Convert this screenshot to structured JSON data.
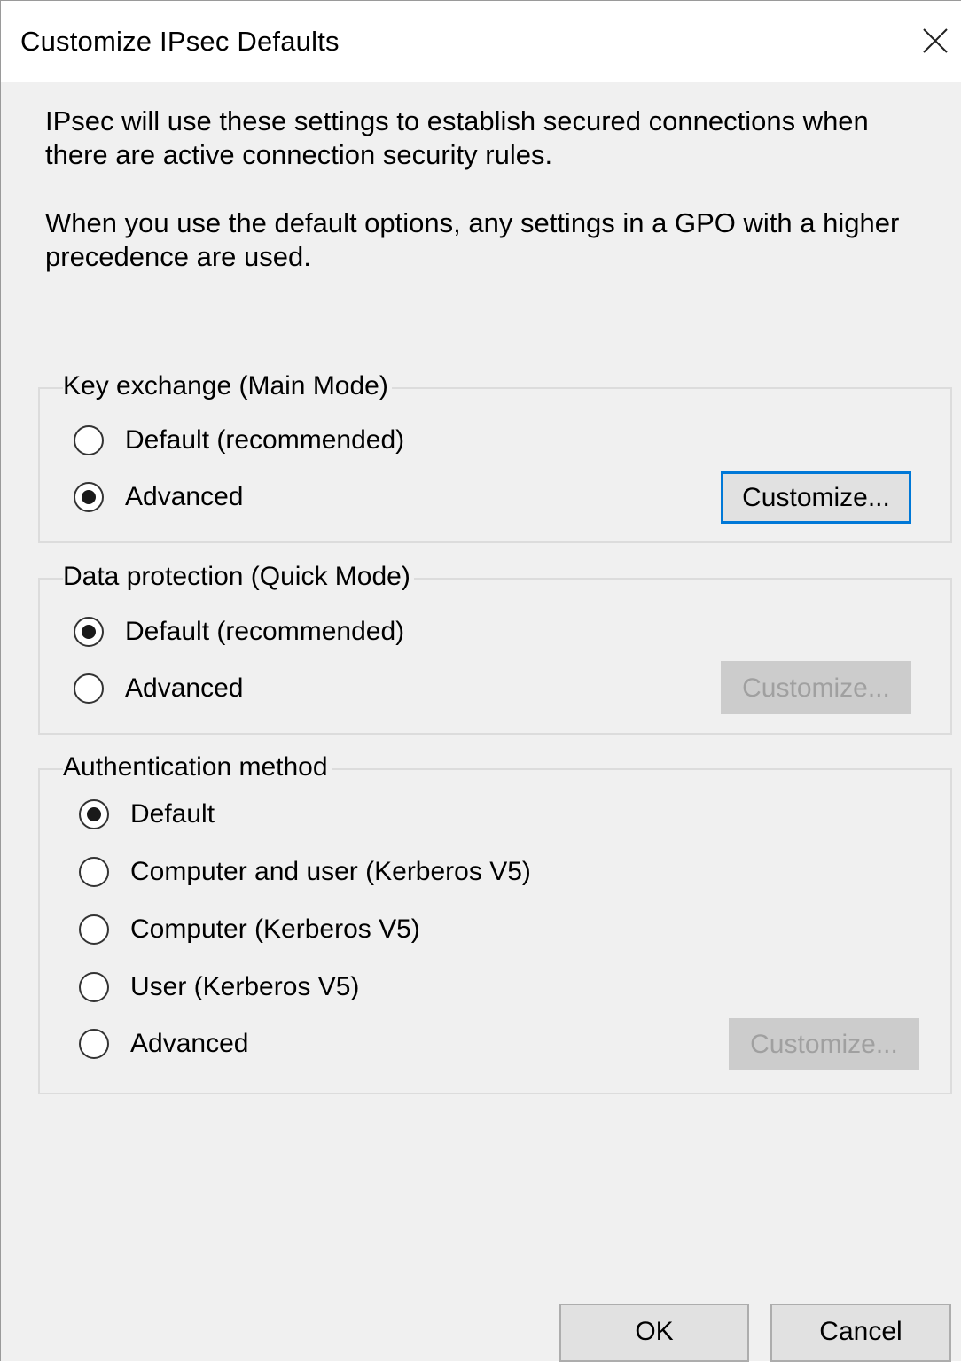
{
  "dialog": {
    "title": "Customize IPsec Defaults",
    "close_icon": "close-icon"
  },
  "intro": {
    "paragraph1": "IPsec will use these settings to establish secured connections when there are active connection security rules.",
    "paragraph2": "When you use the default options, any settings in a GPO with a higher precedence are used."
  },
  "key_exchange": {
    "legend": "Key exchange (Main Mode)",
    "options": [
      {
        "label": "Default (recommended)",
        "checked": false
      },
      {
        "label": "Advanced",
        "checked": true
      }
    ],
    "customize_label": "Customize...",
    "customize_enabled": true
  },
  "data_protection": {
    "legend": "Data protection (Quick Mode)",
    "options": [
      {
        "label": "Default (recommended)",
        "checked": true
      },
      {
        "label": "Advanced",
        "checked": false
      }
    ],
    "customize_label": "Customize...",
    "customize_enabled": false
  },
  "authentication": {
    "legend": "Authentication method",
    "options": [
      {
        "label": "Default",
        "checked": true
      },
      {
        "label": "Computer and user (Kerberos V5)",
        "checked": false
      },
      {
        "label": "Computer (Kerberos V5)",
        "checked": false
      },
      {
        "label": "User (Kerberos V5)",
        "checked": false
      },
      {
        "label": "Advanced",
        "checked": false
      }
    ],
    "customize_label": "Customize...",
    "customize_enabled": false
  },
  "footer": {
    "ok_label": "OK",
    "cancel_label": "Cancel"
  },
  "colors": {
    "focus_border": "#0078d7",
    "dialog_background": "#f0f0f0",
    "disabled_button": "#cccccc"
  }
}
